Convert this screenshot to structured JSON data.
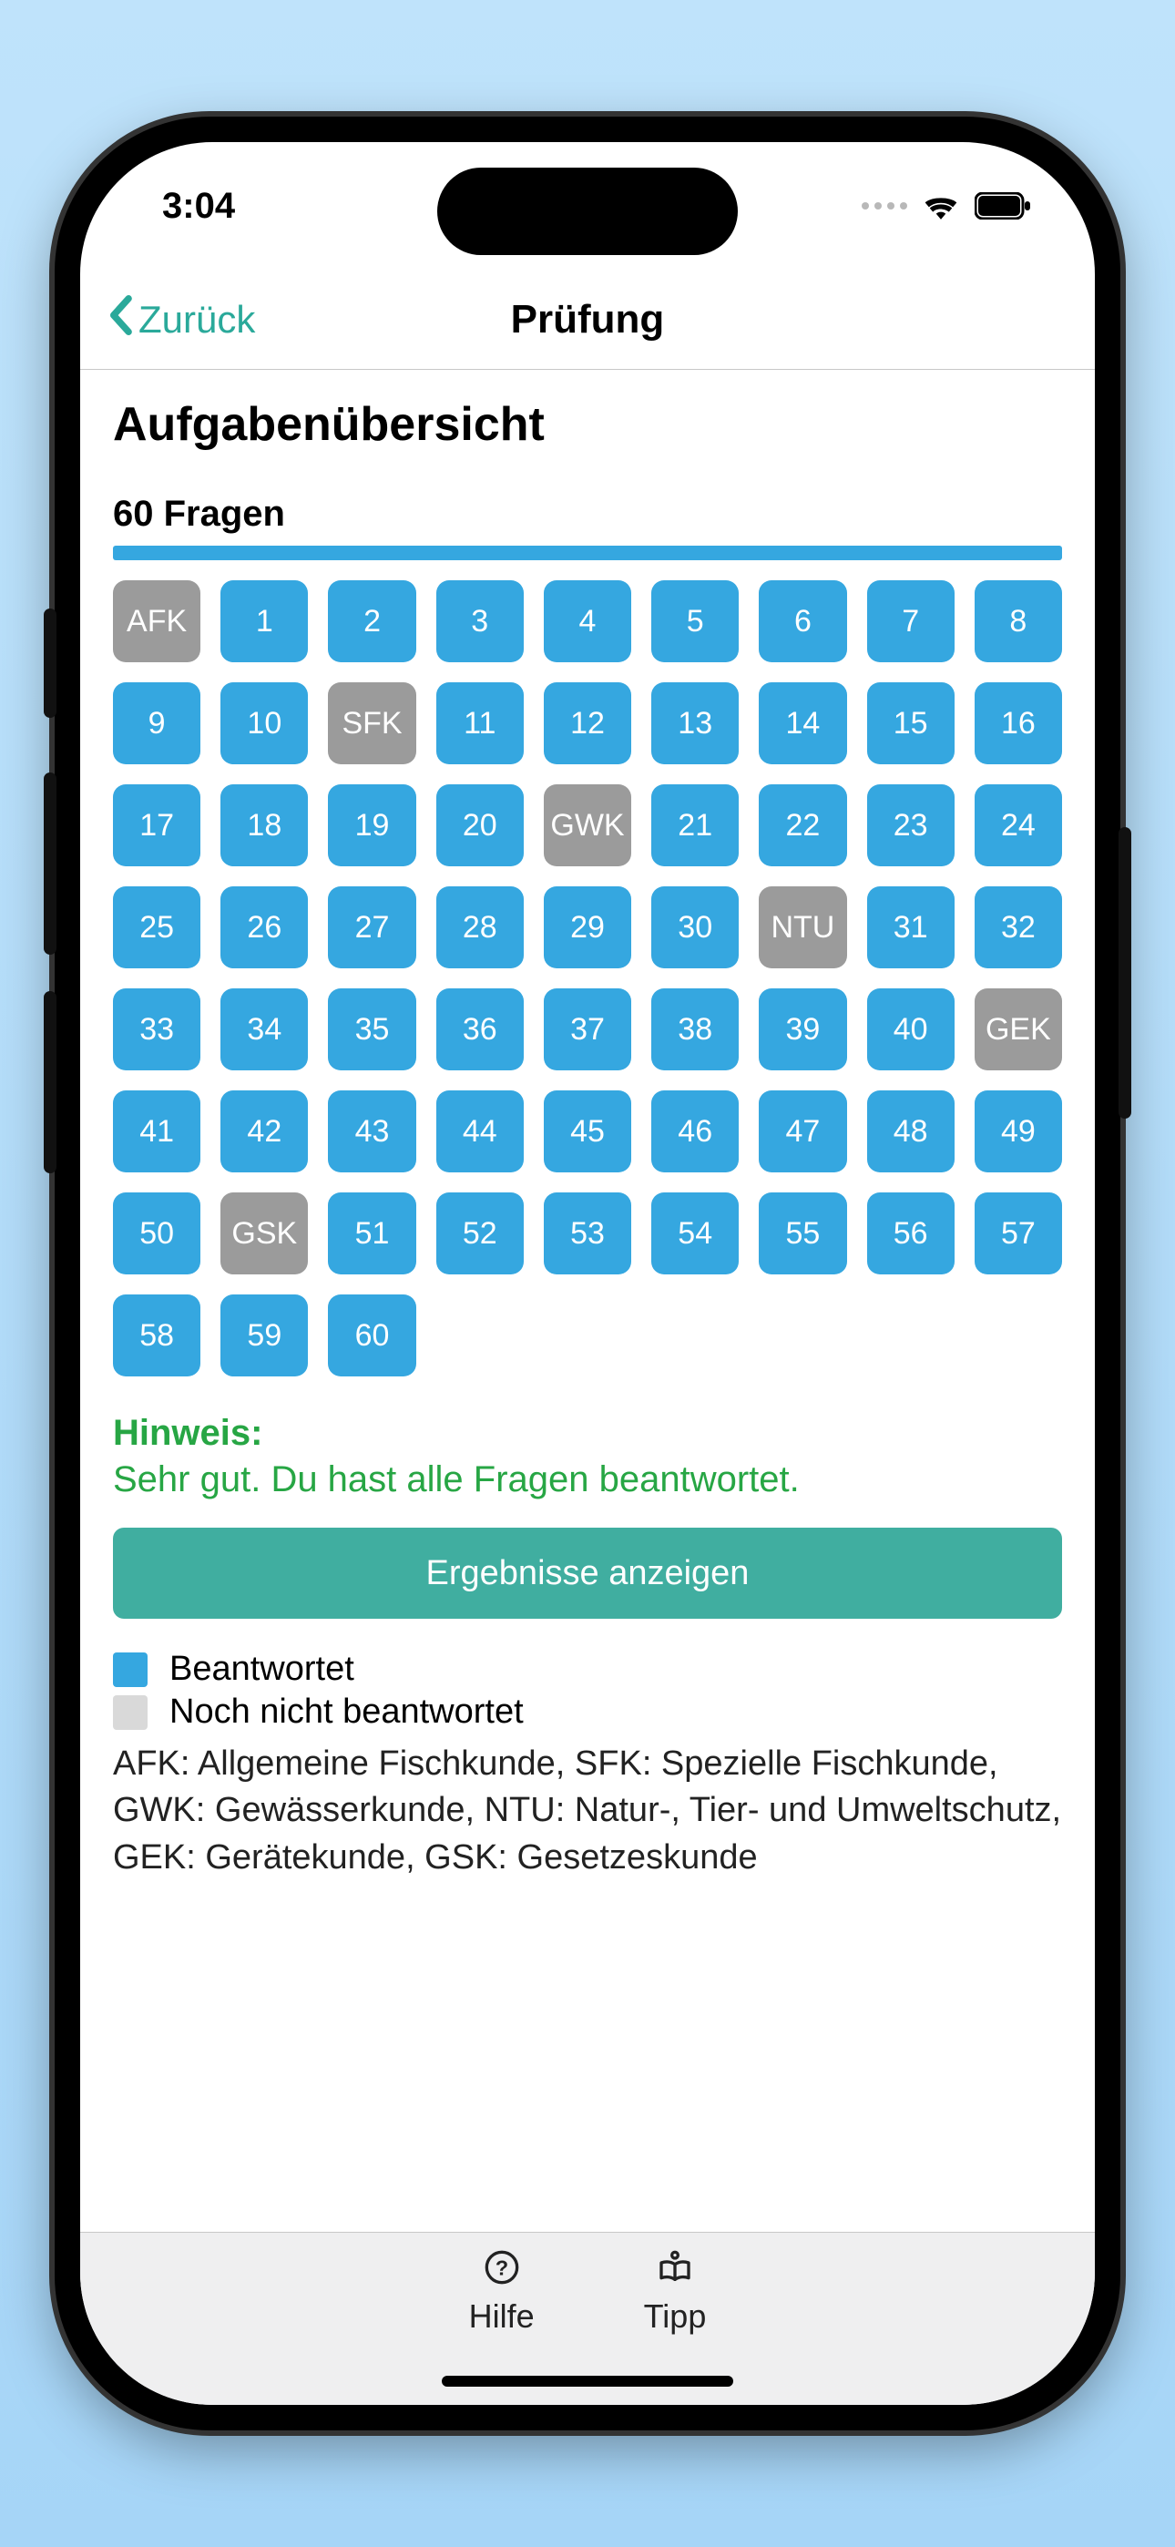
{
  "status": {
    "time": "3:04"
  },
  "nav": {
    "back": "Zurück",
    "title": "Prüfung"
  },
  "page": {
    "title": "Aufgabenübersicht",
    "subtitle": "60 Fragen"
  },
  "cells": [
    {
      "label": "AFK",
      "kind": "gray"
    },
    {
      "label": "1",
      "kind": "blue"
    },
    {
      "label": "2",
      "kind": "blue"
    },
    {
      "label": "3",
      "kind": "blue"
    },
    {
      "label": "4",
      "kind": "blue"
    },
    {
      "label": "5",
      "kind": "blue"
    },
    {
      "label": "6",
      "kind": "blue"
    },
    {
      "label": "7",
      "kind": "blue"
    },
    {
      "label": "8",
      "kind": "blue"
    },
    {
      "label": "9",
      "kind": "blue"
    },
    {
      "label": "10",
      "kind": "blue"
    },
    {
      "label": "SFK",
      "kind": "gray"
    },
    {
      "label": "11",
      "kind": "blue"
    },
    {
      "label": "12",
      "kind": "blue"
    },
    {
      "label": "13",
      "kind": "blue"
    },
    {
      "label": "14",
      "kind": "blue"
    },
    {
      "label": "15",
      "kind": "blue"
    },
    {
      "label": "16",
      "kind": "blue"
    },
    {
      "label": "17",
      "kind": "blue"
    },
    {
      "label": "18",
      "kind": "blue"
    },
    {
      "label": "19",
      "kind": "blue"
    },
    {
      "label": "20",
      "kind": "blue"
    },
    {
      "label": "GWK",
      "kind": "gray"
    },
    {
      "label": "21",
      "kind": "blue"
    },
    {
      "label": "22",
      "kind": "blue"
    },
    {
      "label": "23",
      "kind": "blue"
    },
    {
      "label": "24",
      "kind": "blue"
    },
    {
      "label": "25",
      "kind": "blue"
    },
    {
      "label": "26",
      "kind": "blue"
    },
    {
      "label": "27",
      "kind": "blue"
    },
    {
      "label": "28",
      "kind": "blue"
    },
    {
      "label": "29",
      "kind": "blue"
    },
    {
      "label": "30",
      "kind": "blue"
    },
    {
      "label": "NTU",
      "kind": "gray"
    },
    {
      "label": "31",
      "kind": "blue"
    },
    {
      "label": "32",
      "kind": "blue"
    },
    {
      "label": "33",
      "kind": "blue"
    },
    {
      "label": "34",
      "kind": "blue"
    },
    {
      "label": "35",
      "kind": "blue"
    },
    {
      "label": "36",
      "kind": "blue"
    },
    {
      "label": "37",
      "kind": "blue"
    },
    {
      "label": "38",
      "kind": "blue"
    },
    {
      "label": "39",
      "kind": "blue"
    },
    {
      "label": "40",
      "kind": "blue"
    },
    {
      "label": "GEK",
      "kind": "gray"
    },
    {
      "label": "41",
      "kind": "blue"
    },
    {
      "label": "42",
      "kind": "blue"
    },
    {
      "label": "43",
      "kind": "blue"
    },
    {
      "label": "44",
      "kind": "blue"
    },
    {
      "label": "45",
      "kind": "blue"
    },
    {
      "label": "46",
      "kind": "blue"
    },
    {
      "label": "47",
      "kind": "blue"
    },
    {
      "label": "48",
      "kind": "blue"
    },
    {
      "label": "49",
      "kind": "blue"
    },
    {
      "label": "50",
      "kind": "blue"
    },
    {
      "label": "GSK",
      "kind": "gray"
    },
    {
      "label": "51",
      "kind": "blue"
    },
    {
      "label": "52",
      "kind": "blue"
    },
    {
      "label": "53",
      "kind": "blue"
    },
    {
      "label": "54",
      "kind": "blue"
    },
    {
      "label": "55",
      "kind": "blue"
    },
    {
      "label": "56",
      "kind": "blue"
    },
    {
      "label": "57",
      "kind": "blue"
    },
    {
      "label": "58",
      "kind": "blue"
    },
    {
      "label": "59",
      "kind": "blue"
    },
    {
      "label": "60",
      "kind": "blue"
    }
  ],
  "hint": {
    "title": "Hinweis:",
    "text": "Sehr gut. Du hast alle Fragen beantwortet."
  },
  "results_button": "Ergebnisse anzeigen",
  "legend": {
    "answered": "Beantwortet",
    "unanswered": "Noch nicht beantwortet",
    "abbrev": "AFK: Allgemeine Fischkunde, SFK: Spezielle Fischkunde, GWK: Gewässerkunde, NTU: Natur-, Tier- und Umweltschutz, GEK: Gerätekunde, GSK: Gesetzeskunde"
  },
  "tabs": {
    "help": "Hilfe",
    "tip": "Tipp"
  }
}
